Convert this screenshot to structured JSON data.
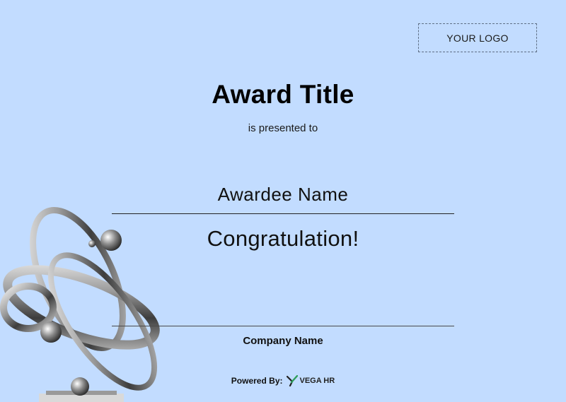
{
  "logo": {
    "label": "YOUR LOGO"
  },
  "certificate": {
    "title": "Award Title",
    "subtitle": "is presented to",
    "awardee": "Awardee Name",
    "message": "Congratulation!",
    "company": "Company Name"
  },
  "footer": {
    "powered_label": "Powered By:",
    "brand_name": "VEGA HR"
  },
  "colors": {
    "background": "#c2dcff",
    "brand_green": "#2e9e5b"
  }
}
